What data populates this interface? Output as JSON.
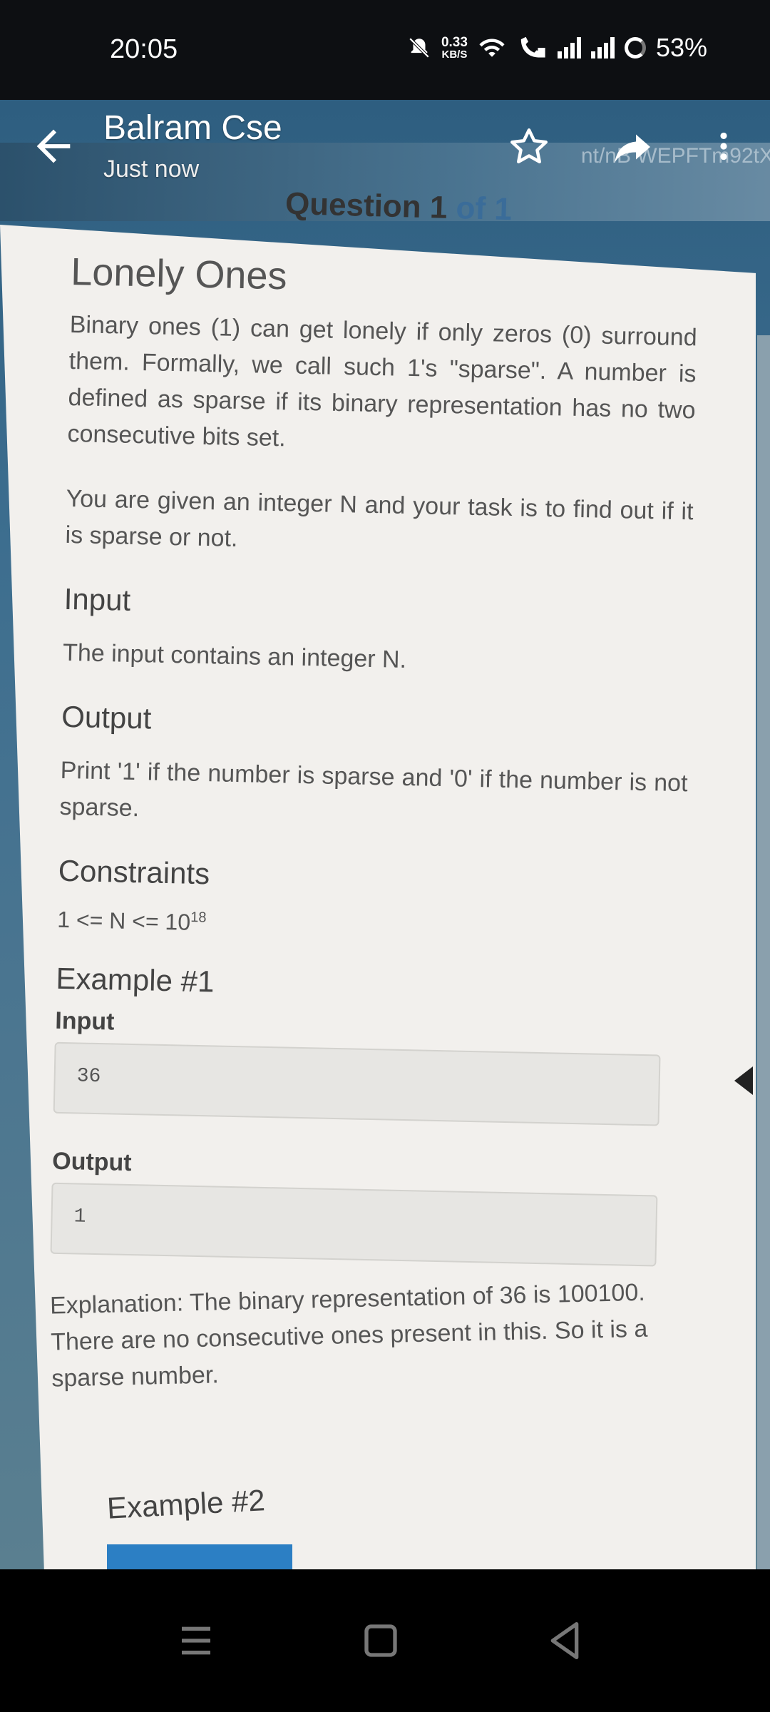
{
  "status": {
    "time": "20:05",
    "net_speed_value": "0.33",
    "net_speed_unit": "KB/S",
    "battery": "53%"
  },
  "app_bar": {
    "sender": "Balram Cse",
    "time_ago": "Just now",
    "url_fragment": "nt/nB  WEPFTm92tX"
  },
  "photo": {
    "question_header": "Question",
    "question_num": "1",
    "question_of": "of 1",
    "title": "Lonely Ones",
    "para1": "Binary ones (1) can get lonely if only zeros (0) surround them. Formally, we call such 1's \"sparse\". A number is defined as sparse if its binary representation has no two consecutive bits set.",
    "para2": "You are given an integer N and your task is to find out if it is sparse or not.",
    "input_heading": "Input",
    "input_text": "The input contains an integer N.",
    "output_heading": "Output",
    "output_text": "Print '1' if the number is sparse and '0' if the number is not sparse.",
    "constraints_heading": "Constraints",
    "constraint_base": "1 <= N <= 10",
    "constraint_exp": "18",
    "example1_title": "Example #1",
    "example1_input_label": "Input",
    "example1_input": "36",
    "example1_output_label": "Output",
    "example1_output": "1",
    "explanation": "Explanation: The binary representation of 36 is 100100. There are no consecutive ones present in this.  So it is a sparse number.",
    "example2_title": "Example #2"
  }
}
